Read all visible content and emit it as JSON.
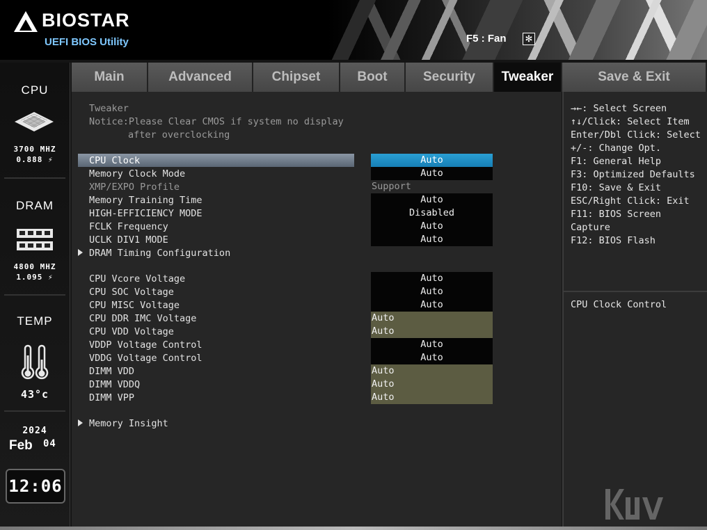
{
  "header": {
    "brand": "BIOSTAR",
    "subtitle": "UEFI BIOS Utility",
    "fan_hint": "F5 : Fan"
  },
  "status": {
    "cpu": {
      "title": "CPU",
      "freq": "3700 MHZ",
      "volt": "0.888 ⚡"
    },
    "dram": {
      "title": "DRAM",
      "freq": "4800 MHZ",
      "volt": "1.095 ⚡"
    },
    "temp": {
      "title": "TEMP",
      "value": "43°c"
    },
    "date": {
      "year": "2024",
      "month": "Feb",
      "day": "04"
    },
    "time": "12:06"
  },
  "tabs": [
    {
      "label": "Main"
    },
    {
      "label": "Advanced"
    },
    {
      "label": "Chipset"
    },
    {
      "label": "Boot"
    },
    {
      "label": "Security"
    },
    {
      "label": "Tweaker",
      "active": true
    },
    {
      "label": "Save & Exit"
    }
  ],
  "main": {
    "section_title": "Tweaker",
    "notice_line1": "Notice:Please Clear CMOS if system no display",
    "notice_line2": "after overclocking",
    "items": [
      {
        "label": "CPU Clock",
        "value": "Auto"
      },
      {
        "label": "Memory Clock Mode",
        "value": "Auto"
      },
      {
        "label": "XMP/EXPO Profile",
        "value": "Support"
      },
      {
        "label": "Memory Training Time",
        "value": "Auto"
      },
      {
        "label": "HIGH-EFFICIENCY MODE",
        "value": "Disabled"
      },
      {
        "label": "FCLK Frequency",
        "value": "Auto"
      },
      {
        "label": "UCLK DIV1 MODE",
        "value": "Auto"
      },
      {
        "label": "DRAM Timing Configuration"
      },
      {
        "label": "CPU Vcore Voltage",
        "value": "Auto"
      },
      {
        "label": "CPU SOC Voltage",
        "value": "Auto"
      },
      {
        "label": "CPU MISC Voltage",
        "value": "Auto"
      },
      {
        "label": "CPU DDR IMC Voltage",
        "value": "Auto"
      },
      {
        "label": "CPU VDD Voltage",
        "value": "Auto"
      },
      {
        "label": "VDDP Voltage Control",
        "value": "Auto"
      },
      {
        "label": "VDDG Voltage Control",
        "value": "Auto"
      },
      {
        "label": "DIMM VDD",
        "value": "Auto"
      },
      {
        "label": "DIMM VDDQ",
        "value": "Auto"
      },
      {
        "label": "DIMM VPP",
        "value": "Auto"
      },
      {
        "label": "Memory Insight"
      }
    ]
  },
  "help": {
    "lines": [
      "→←: Select Screen",
      "↑↓/Click: Select Item",
      "Enter/Dbl Click: Select",
      "+/-: Change Opt.",
      "F1: General Help",
      "F3: Optimized Defaults",
      "F10: Save & Exit",
      "ESC/Right Click: Exit",
      "F11: BIOS Screen",
      "Capture",
      "F12: BIOS Flash"
    ],
    "description": "CPU Clock Control"
  },
  "colors": {
    "selected_value": "#2a9fd4",
    "voltage_value": "#5c5c42",
    "logo_accent": "#7fc8ff"
  }
}
